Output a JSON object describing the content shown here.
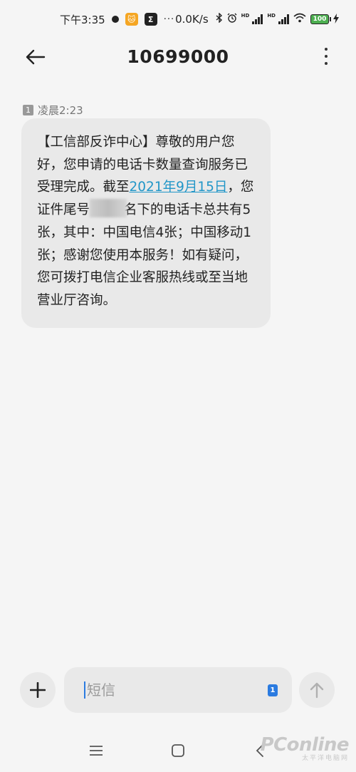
{
  "status_bar": {
    "time": "下午3:35",
    "app_badge_1": "🐱",
    "app_badge_2": "Σ",
    "more": "···",
    "net_speed": "0.0K/s",
    "hd_label": "HD",
    "battery_level": "100"
  },
  "header": {
    "title": "10699000"
  },
  "message": {
    "sim_slot": "1",
    "time": "凌晨2:23",
    "text_part1": "【工信部反诈中心】尊敬的用户您好，您申请的电话卡数量查询服务已受理完成。截至",
    "link_text": "2021年9月15日",
    "text_part2": "，您证件尾号",
    "text_part3": "名下的电话卡总共有5张，其中：中国电信4张；中国移动1张；感谢您使用本服务！如有疑问，您可拨打电信企业客服热线或至当地营业厅咨询。"
  },
  "composer": {
    "placeholder": "短信",
    "sim_slot": "1"
  },
  "watermark": {
    "main": "PConline",
    "sub": "太平洋电脑网"
  },
  "colors": {
    "link": "#2196c8",
    "bubble": "#e9e9e9",
    "accent": "#2b7be0"
  }
}
